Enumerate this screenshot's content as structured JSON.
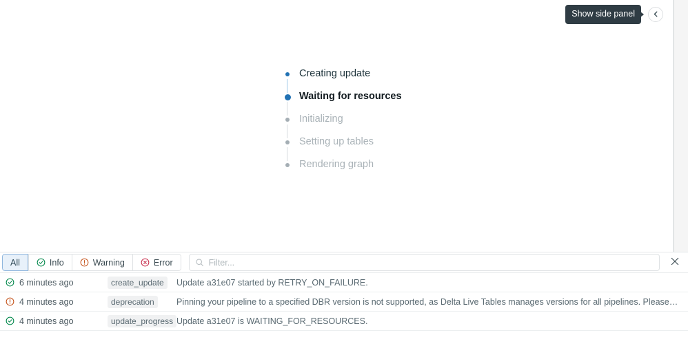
{
  "side_panel": {
    "tooltip_label": "Show side panel",
    "toggle_icon": "chevron-left-icon"
  },
  "progress": {
    "steps": [
      {
        "label": "Creating update",
        "state": "done"
      },
      {
        "label": "Waiting for resources",
        "state": "active"
      },
      {
        "label": "Initializing",
        "state": "pending"
      },
      {
        "label": "Setting up tables",
        "state": "pending"
      },
      {
        "label": "Rendering graph",
        "state": "pending"
      }
    ]
  },
  "event_log": {
    "filters": [
      {
        "label": "All",
        "icon": "none",
        "selected": true
      },
      {
        "label": "Info",
        "icon": "check-circle-icon",
        "selected": false
      },
      {
        "label": "Warning",
        "icon": "warning-circle-icon",
        "selected": false
      },
      {
        "label": "Error",
        "icon": "error-circle-icon",
        "selected": false
      }
    ],
    "search": {
      "icon": "search-icon",
      "value": "",
      "placeholder": "Filter..."
    },
    "close_icon": "close-icon",
    "rows": [
      {
        "status": "info",
        "status_icon": "check-circle-icon",
        "time": "6 minutes ago",
        "type": "create_update",
        "message": "Update a31e07 started by RETRY_ON_FAILURE."
      },
      {
        "status": "warning",
        "status_icon": "warning-circle-icon",
        "time": "4 minutes ago",
        "type": "deprecation",
        "message": "Pinning your pipeline to a specified DBR version is not supported, as Delta Live Tables manages versions for all pipelines. Please remove this setting and instead set \"channel\": \"CURREN..."
      },
      {
        "status": "info",
        "status_icon": "check-circle-icon",
        "time": "4 minutes ago",
        "type": "update_progress",
        "message": "Update a31e07 is WAITING_FOR_RESOURCES."
      }
    ]
  },
  "colors": {
    "accent_blue": "#2272b4",
    "pending_gray": "#a4aeb4",
    "info_green": "#00874a",
    "warning_orange": "#c4521a",
    "error_red": "#c82d4c",
    "tooltip_bg": "#2f3c44"
  }
}
